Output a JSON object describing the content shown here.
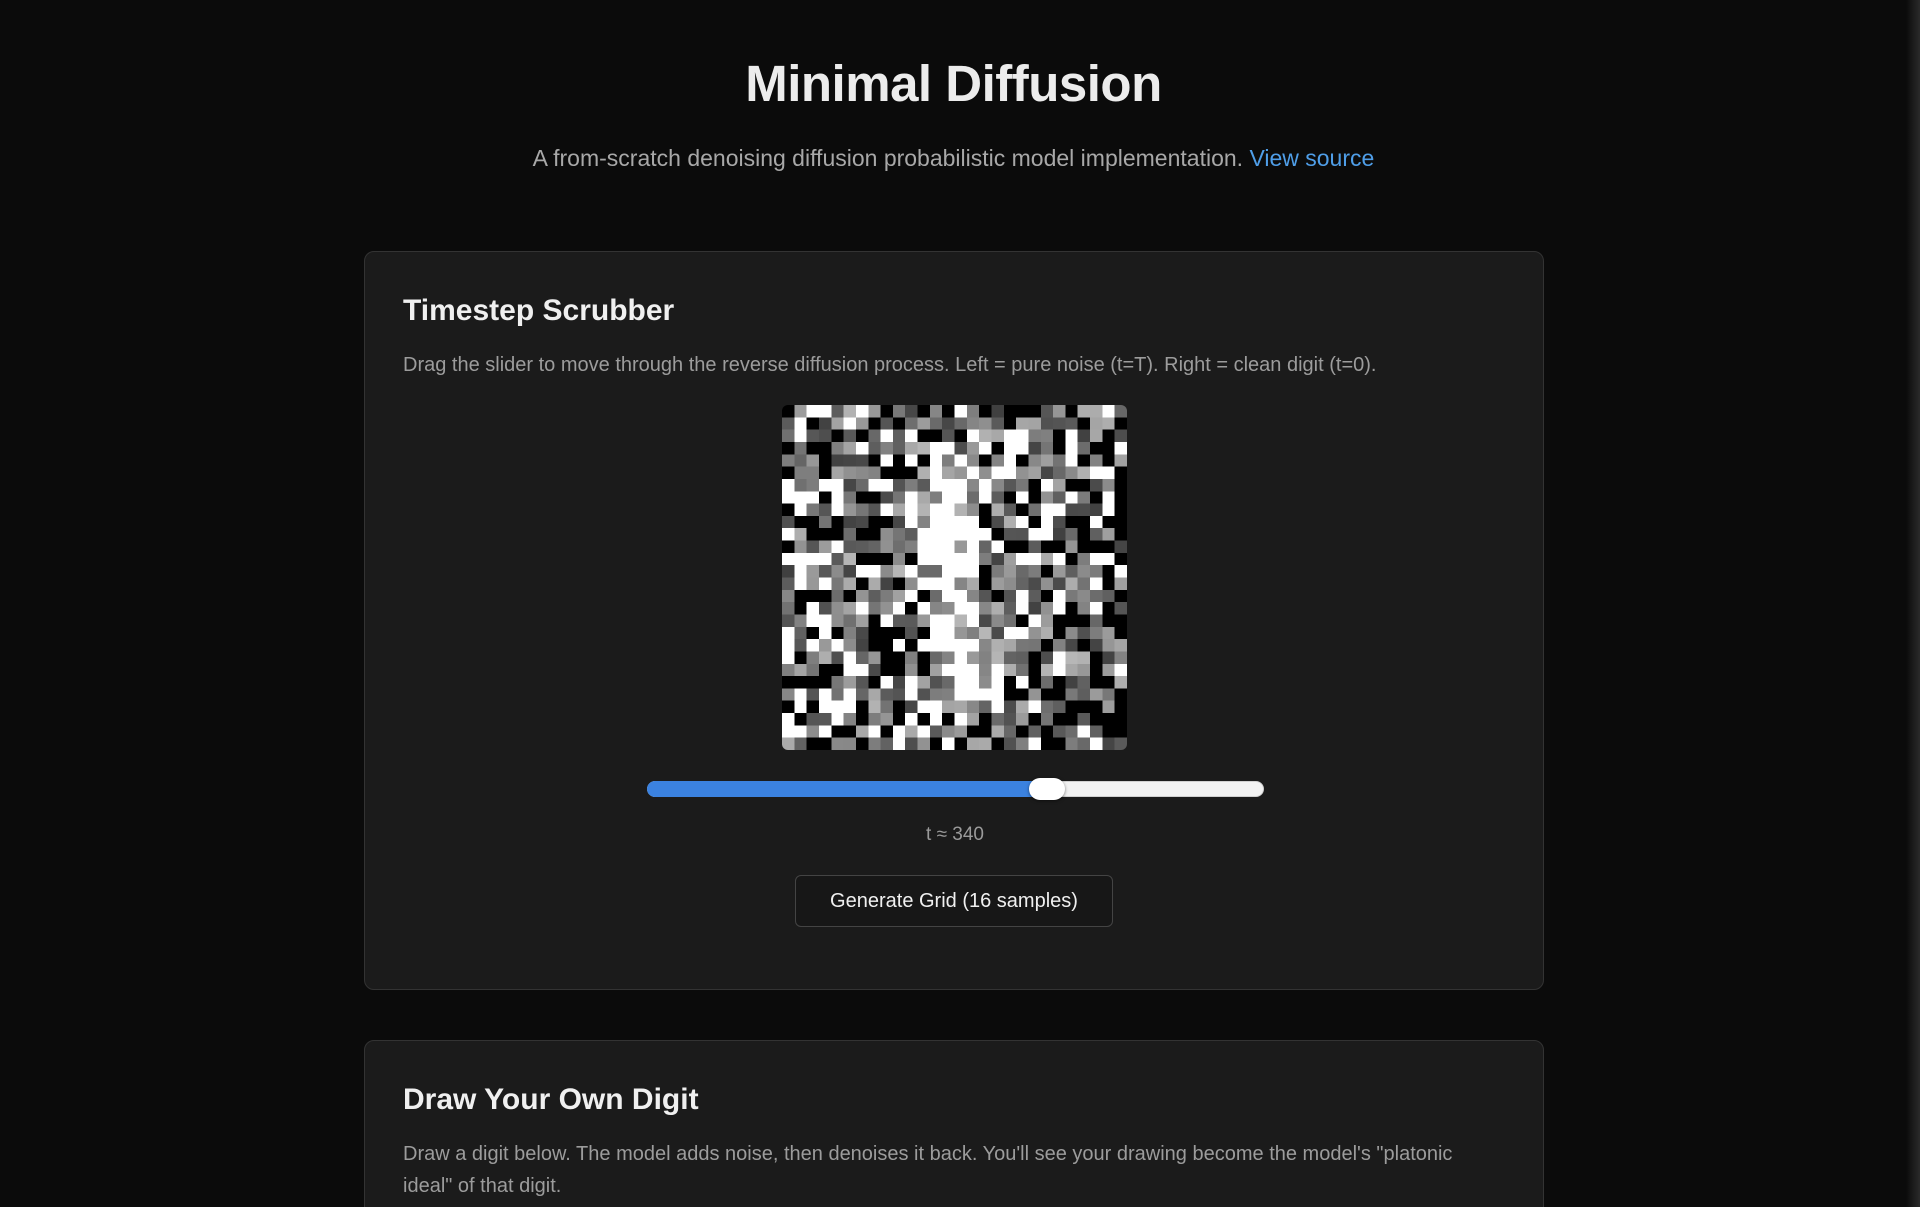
{
  "header": {
    "title": "Minimal Diffusion",
    "subtitle": "A from-scratch denoising diffusion probabilistic model implementation.",
    "source_link_label": "View source"
  },
  "scrubber": {
    "heading": "Timestep Scrubber",
    "description": "Drag the slider to move through the reverse diffusion process. Left = pure noise (t=T). Right = clean digit (t=0).",
    "slider_progress": 0.65,
    "readout": "t ≈ 340",
    "generate_label": "Generate Grid (16 samples)"
  },
  "draw": {
    "heading": "Draw Your Own Digit",
    "description": "Draw a digit below. The model adds noise, then denoises it back. You'll see your drawing become the model's \"platonic ideal\" of that digit."
  },
  "colors": {
    "background": "#0b0b0b",
    "card": "#1b1b1b",
    "accent": "#3b82e0",
    "link": "#4f9ee8"
  }
}
